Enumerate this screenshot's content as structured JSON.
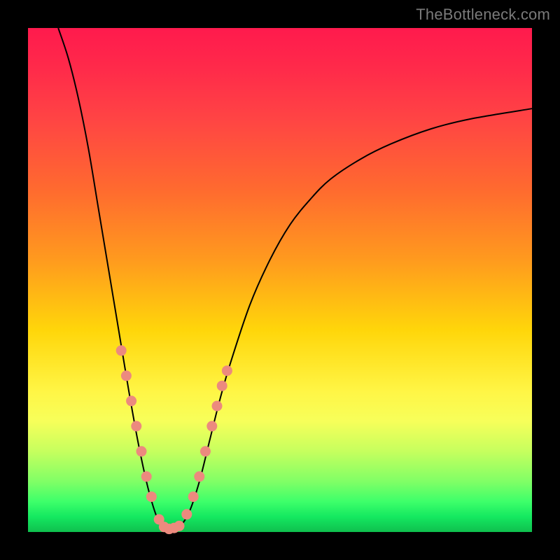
{
  "watermark": "TheBottleneck.com",
  "colors": {
    "frame": "#000000",
    "curve": "#000000",
    "dot": "#ec8a7e",
    "gradient_top": "#ff1a4d",
    "gradient_bottom": "#0fbf4e"
  },
  "chart_data": {
    "type": "line",
    "title": "",
    "xlabel": "",
    "ylabel": "",
    "xlim": [
      0,
      100
    ],
    "ylim": [
      0,
      100
    ],
    "grid": false,
    "legend": false,
    "note": "Axes are unlabeled in the image; coordinates are in percent of plot area (0,0 = bottom-left).",
    "series": [
      {
        "name": "curve",
        "comment": "Steep V-shaped curve; left branch starts near the top-left region, dips to a flat minimum near y≈0 around x≈26-30, then rises along the right branch tapering toward the upper-right.",
        "points": [
          {
            "x": 6,
            "y": 100
          },
          {
            "x": 8,
            "y": 94
          },
          {
            "x": 10,
            "y": 86
          },
          {
            "x": 12,
            "y": 76
          },
          {
            "x": 14,
            "y": 64
          },
          {
            "x": 16,
            "y": 52
          },
          {
            "x": 18,
            "y": 40
          },
          {
            "x": 20,
            "y": 28
          },
          {
            "x": 22,
            "y": 17
          },
          {
            "x": 24,
            "y": 8
          },
          {
            "x": 26,
            "y": 2
          },
          {
            "x": 28,
            "y": 0.5
          },
          {
            "x": 30,
            "y": 1
          },
          {
            "x": 32,
            "y": 4
          },
          {
            "x": 34,
            "y": 10
          },
          {
            "x": 36,
            "y": 18
          },
          {
            "x": 38,
            "y": 26
          },
          {
            "x": 40,
            "y": 33
          },
          {
            "x": 44,
            "y": 45
          },
          {
            "x": 48,
            "y": 54
          },
          {
            "x": 52,
            "y": 61
          },
          {
            "x": 56,
            "y": 66
          },
          {
            "x": 60,
            "y": 70
          },
          {
            "x": 66,
            "y": 74
          },
          {
            "x": 72,
            "y": 77
          },
          {
            "x": 80,
            "y": 80
          },
          {
            "x": 88,
            "y": 82
          },
          {
            "x": 100,
            "y": 84
          }
        ]
      },
      {
        "name": "dots",
        "comment": "Salmon/pink sample points clustered on the lower portion of both branches and along the flat minimum.",
        "points": [
          {
            "x": 18.5,
            "y": 36
          },
          {
            "x": 19.5,
            "y": 31
          },
          {
            "x": 20.5,
            "y": 26
          },
          {
            "x": 21.5,
            "y": 21
          },
          {
            "x": 22.5,
            "y": 16
          },
          {
            "x": 23.5,
            "y": 11
          },
          {
            "x": 24.5,
            "y": 7
          },
          {
            "x": 26.0,
            "y": 2.5
          },
          {
            "x": 27.0,
            "y": 1.0
          },
          {
            "x": 28.0,
            "y": 0.6
          },
          {
            "x": 29.0,
            "y": 0.8
          },
          {
            "x": 30.0,
            "y": 1.2
          },
          {
            "x": 31.5,
            "y": 3.5
          },
          {
            "x": 32.8,
            "y": 7
          },
          {
            "x": 34.0,
            "y": 11
          },
          {
            "x": 35.2,
            "y": 16
          },
          {
            "x": 36.5,
            "y": 21
          },
          {
            "x": 37.5,
            "y": 25
          },
          {
            "x": 38.5,
            "y": 29
          },
          {
            "x": 39.5,
            "y": 32
          }
        ]
      }
    ]
  }
}
